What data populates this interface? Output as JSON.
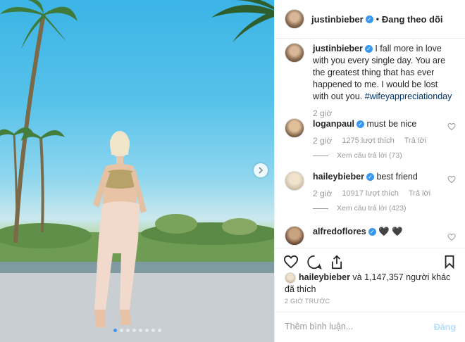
{
  "post": {
    "username": "justinbieber",
    "follow_state": "Đang theo dõi",
    "separator": "•",
    "caption_text": "I fall more in love with you every single day. You are the greatest thing that has ever happened to me. I would be lost with out you.",
    "hashtag": "#wifeyappreciationday",
    "caption_time": "2 giờ",
    "carousel_count": 8,
    "carousel_active": 0
  },
  "comments": [
    {
      "username": "loganpaul",
      "text": "must be nice",
      "time": "2 giờ",
      "likes": "1275 lượt thích",
      "reply": "Trả lời",
      "view_replies": "Xem câu trả lời (73)"
    },
    {
      "username": "haileybieber",
      "text": "best friend",
      "time": "2 giờ",
      "likes": "10917 lượt thích",
      "reply": "Trả lời",
      "view_replies": "Xem câu trả lời (423)"
    },
    {
      "username": "alfredoflores",
      "text": "🖤 🖤"
    }
  ],
  "likes": {
    "text_prefix": "haileybieber",
    "text_suffix": " và 1,147,357 người khác đã thích"
  },
  "time_ago": "2 GIỜ TRƯỚC",
  "comment_box": {
    "placeholder": "Thêm bình luận...",
    "post_label": "Đăng"
  },
  "colors": {
    "accent": "#3897f0",
    "muted": "#999999",
    "post_disabled": "#b2dffc",
    "hashtag": "#003569"
  }
}
